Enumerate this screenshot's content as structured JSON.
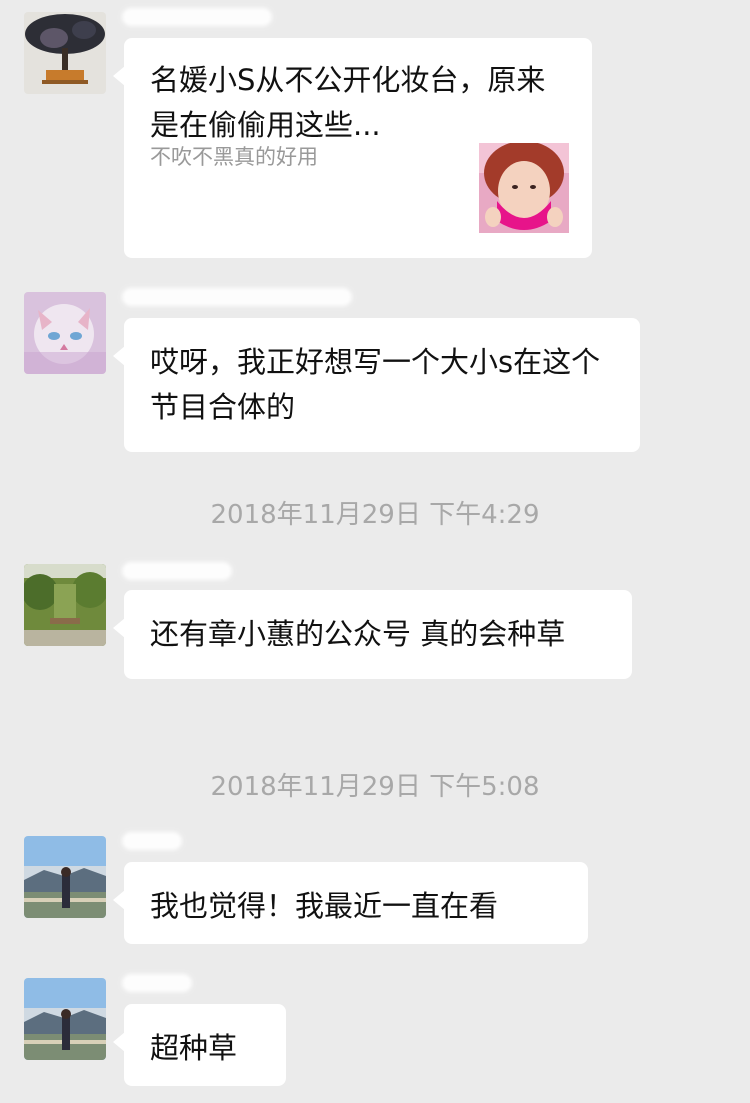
{
  "messages": [
    {
      "type": "share_card",
      "title": "名媛小S从不公开化妆台，原来是在偷偷用这些...",
      "description": "不吹不黑真的好用"
    },
    {
      "type": "text",
      "text": "哎呀，我正好想写一个大小s在这个节目合体的"
    },
    {
      "type": "text",
      "text": "还有章小蕙的公众号 真的会种草"
    },
    {
      "type": "text",
      "text": "我也觉得！我最近一直在看"
    },
    {
      "type": "text",
      "text": "超种草"
    }
  ],
  "timestamps": [
    "2018年11月29日 下午4:29",
    "2018年11月29日 下午5:08"
  ]
}
